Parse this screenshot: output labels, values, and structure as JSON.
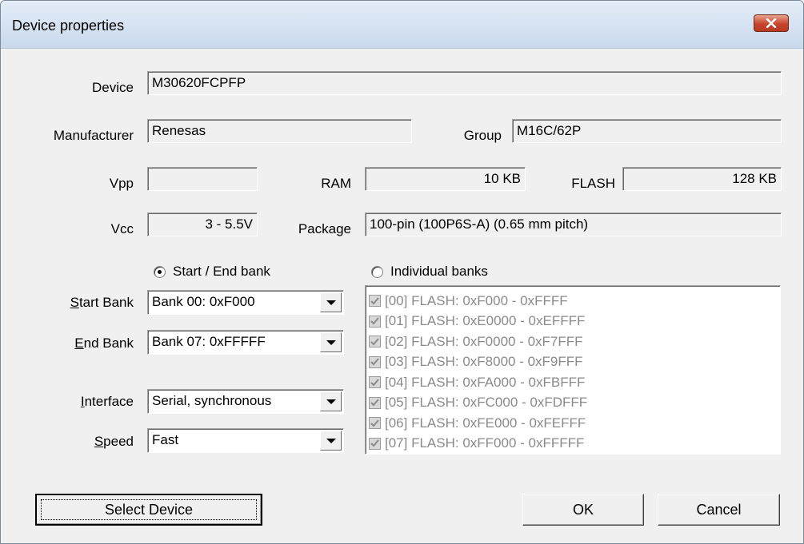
{
  "window": {
    "title": "Device properties"
  },
  "fields": {
    "device": {
      "label": "Device",
      "value": "M30620FCPFP"
    },
    "manufacturer": {
      "label": "Manufacturer",
      "value": "Renesas"
    },
    "group": {
      "label": "Group",
      "value": "M16C/62P"
    },
    "vpp": {
      "label": "Vpp",
      "value": ""
    },
    "ram": {
      "label": "RAM",
      "value": "10 KB"
    },
    "flash": {
      "label": "FLASH",
      "value": "128 KB"
    },
    "vcc": {
      "label": "Vcc",
      "value": "3 - 5.5V"
    },
    "package": {
      "label": "Package",
      "value": "100-pin (100P6S-A) (0.65 mm pitch)"
    }
  },
  "bank_mode": {
    "start_end_label": "Start / End bank",
    "individual_label": "Individual banks",
    "selected": "start_end"
  },
  "combos": {
    "start_bank": {
      "label_key": "S",
      "label_rest": "tart Bank",
      "value": "Bank 00: 0xF000"
    },
    "end_bank": {
      "label_key": "E",
      "label_rest": "nd Bank",
      "value": "Bank 07: 0xFFFFF"
    },
    "interface": {
      "label_key": "I",
      "label_rest": "nterface",
      "value": "Serial, synchronous"
    },
    "speed": {
      "label_key": "S",
      "label_rest": "peed",
      "value": "Fast"
    }
  },
  "banks": [
    {
      "label": "[00] FLASH: 0xF000 - 0xFFFF",
      "checked": true
    },
    {
      "label": "[01] FLASH: 0xE0000 - 0xEFFFF",
      "checked": true
    },
    {
      "label": "[02] FLASH: 0xF0000 - 0xF7FFF",
      "checked": true
    },
    {
      "label": "[03] FLASH: 0xF8000 - 0xF9FFF",
      "checked": true
    },
    {
      "label": "[04] FLASH: 0xFA000 - 0xFBFFF",
      "checked": true
    },
    {
      "label": "[05] FLASH: 0xFC000 - 0xFDFFF",
      "checked": true
    },
    {
      "label": "[06] FLASH: 0xFE000 - 0xFEFFF",
      "checked": true
    },
    {
      "label": "[07] FLASH: 0xFF000 - 0xFFFFF",
      "checked": true
    }
  ],
  "buttons": {
    "select_device": "Select Device",
    "ok": "OK",
    "cancel": "Cancel"
  },
  "colors": {
    "dialog_bg": "#f0f0f0",
    "close_button": "#c7452c",
    "disabled_text": "#8a8a8a"
  }
}
